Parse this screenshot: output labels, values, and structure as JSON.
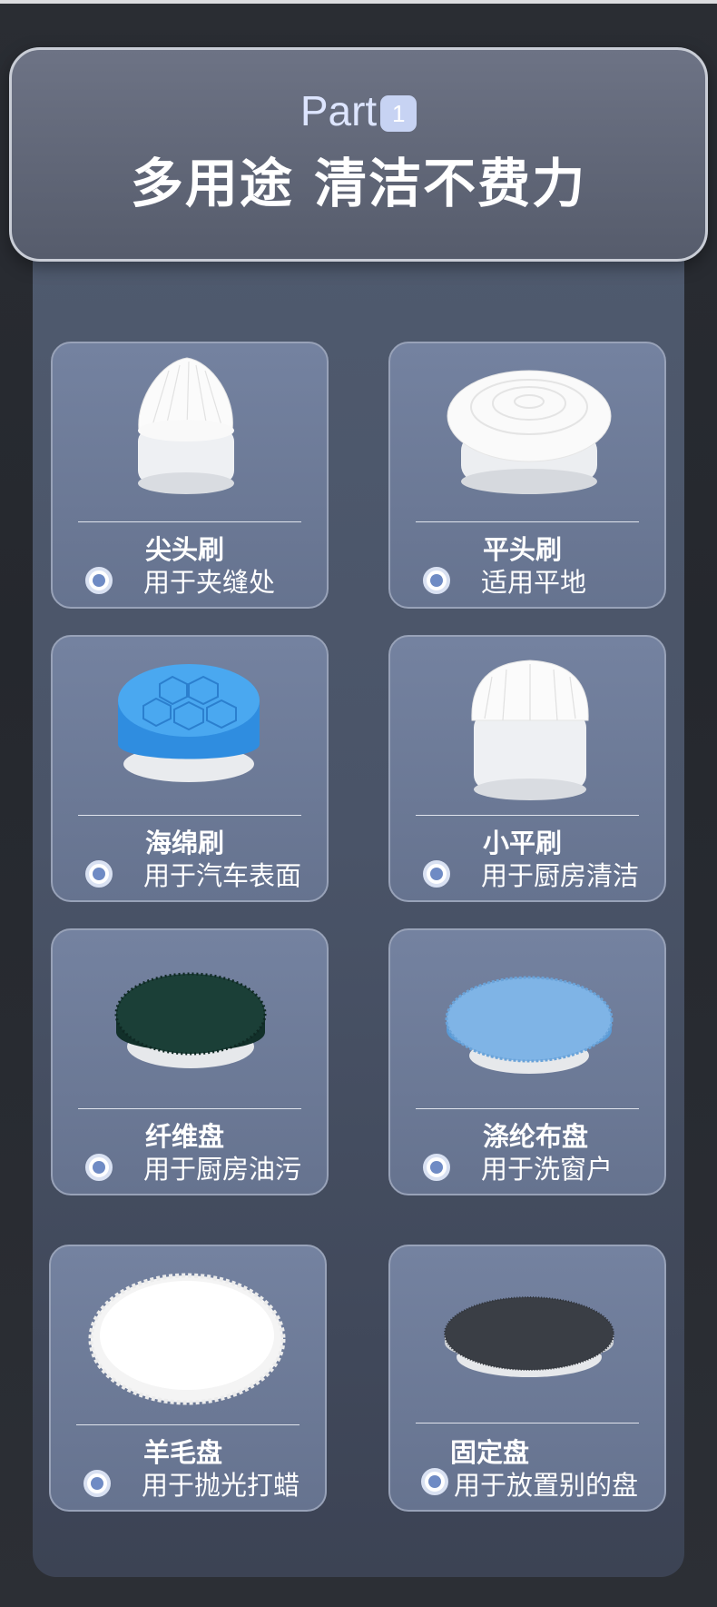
{
  "header": {
    "part_label": "Part",
    "part_number": "1",
    "headline": "多用途 清洁不费力"
  },
  "cards": [
    {
      "name": "尖头刷",
      "desc": "用于夹缝处",
      "image": "pointed-brush-head"
    },
    {
      "name": "平头刷",
      "desc": "适用平地",
      "image": "flat-brush-head"
    },
    {
      "name": "海绵刷",
      "desc": "用于汽车表面",
      "image": "blue-sponge-pad"
    },
    {
      "name": "小平刷",
      "desc": "用于厨房清洁",
      "image": "small-flat-brush"
    },
    {
      "name": "纤维盘",
      "desc": "用于厨房油污",
      "image": "green-scouring-pad"
    },
    {
      "name": "涤纶布盘",
      "desc": "用于洗窗户",
      "image": "blue-microfiber-pad"
    },
    {
      "name": "羊毛盘",
      "desc": "用于抛光打蜡",
      "image": "white-wool-pad"
    },
    {
      "name": "固定盘",
      "desc": "用于放置别的盘",
      "image": "backing-plate"
    }
  ],
  "colors": {
    "panel": "#4f5a6e",
    "card": "#7482a0",
    "accent": "#6f8bc4",
    "badge": "#c7d3f3"
  }
}
